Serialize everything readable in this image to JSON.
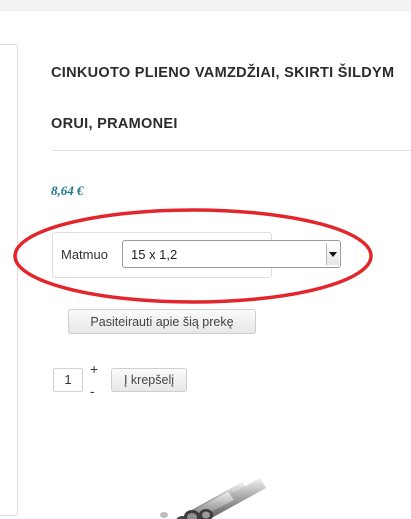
{
  "product": {
    "title_line1": "CINKUOTO PLIENO VAMZDŽIAI, SKIRTI ŠILDYM",
    "title_line2": "ORUI, PRAMONEI",
    "price": "8,64 €"
  },
  "variant": {
    "label": "Matmuo",
    "selected": "15 x 1,2"
  },
  "actions": {
    "ask_label": "Pasiteirauti apie šią prekę",
    "add_to_cart_label": "Į krepšelį"
  },
  "quantity": {
    "value": "1",
    "increase_label": "+",
    "decrease_label": "-"
  },
  "colors": {
    "price": "#1f7690",
    "highlight": "#e3262c"
  }
}
